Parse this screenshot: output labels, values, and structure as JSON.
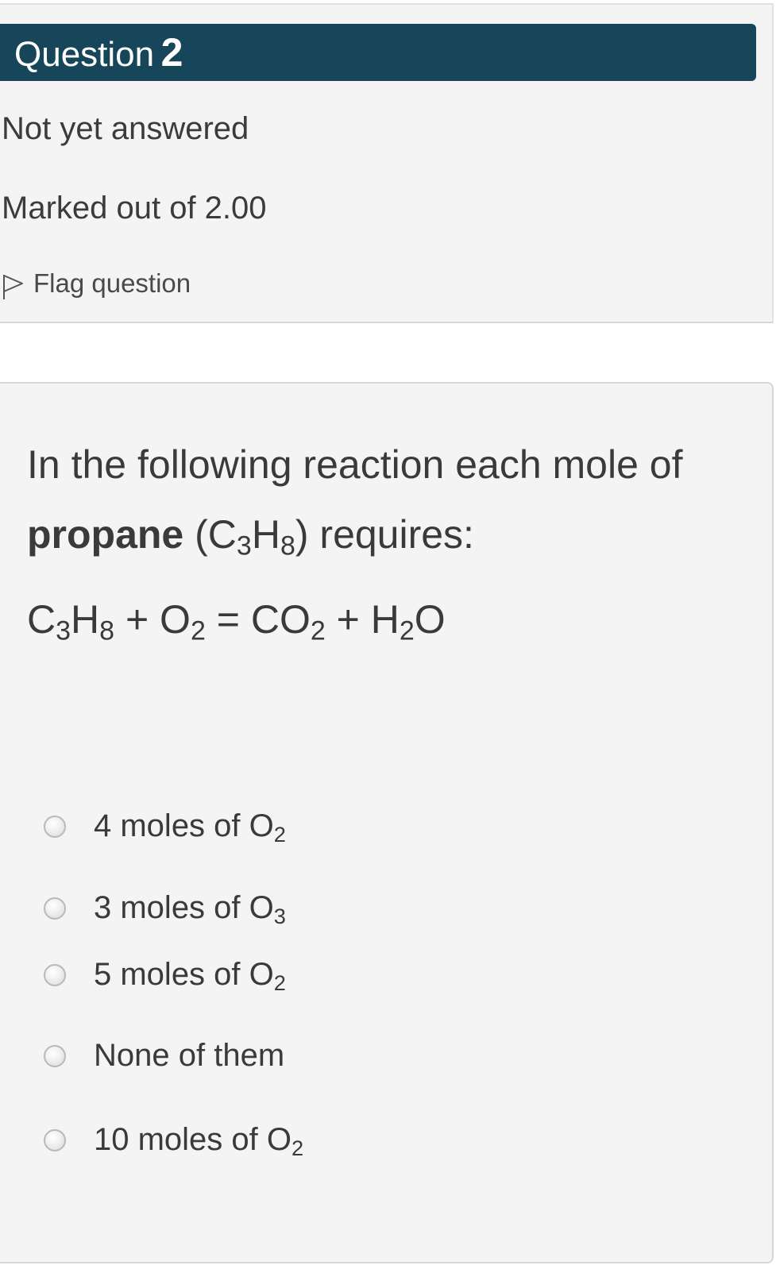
{
  "info": {
    "question_label": "Question",
    "question_number": "2",
    "state": "Not yet answered",
    "grade": "Marked out of 2.00",
    "flag_label": "Flag question"
  },
  "question": {
    "intro": "In the following reaction each mole of",
    "bold_word": "propane",
    "formula_open": "(C",
    "formula_c_sub": "3",
    "formula_h": "H",
    "formula_h_sub": "8",
    "formula_close": ") requires:",
    "equation": {
      "c": "C",
      "c_sub": "3",
      "h": "H",
      "h_sub": "8",
      "plus1": " + O",
      "o2_sub": "2",
      "eq": " = CO",
      "co2_sub": "2",
      "plus2": " + H",
      "h2o_sub": "2",
      "o_end": "O"
    }
  },
  "options": [
    {
      "text": "4 moles of O",
      "sub": "2"
    },
    {
      "text": "3 moles of O",
      "sub": "3"
    },
    {
      "text": "5 moles of O",
      "sub": "2"
    },
    {
      "text": "None of them",
      "sub": ""
    },
    {
      "text": "10 moles of O",
      "sub": "2"
    }
  ],
  "colors": {
    "header_bar": "#17465a",
    "panel_bg": "#f4f4f4",
    "text": "#3a3a3a"
  },
  "icons": {
    "flag": "flag-outline-icon",
    "radio": "radio-unchecked-icon"
  }
}
